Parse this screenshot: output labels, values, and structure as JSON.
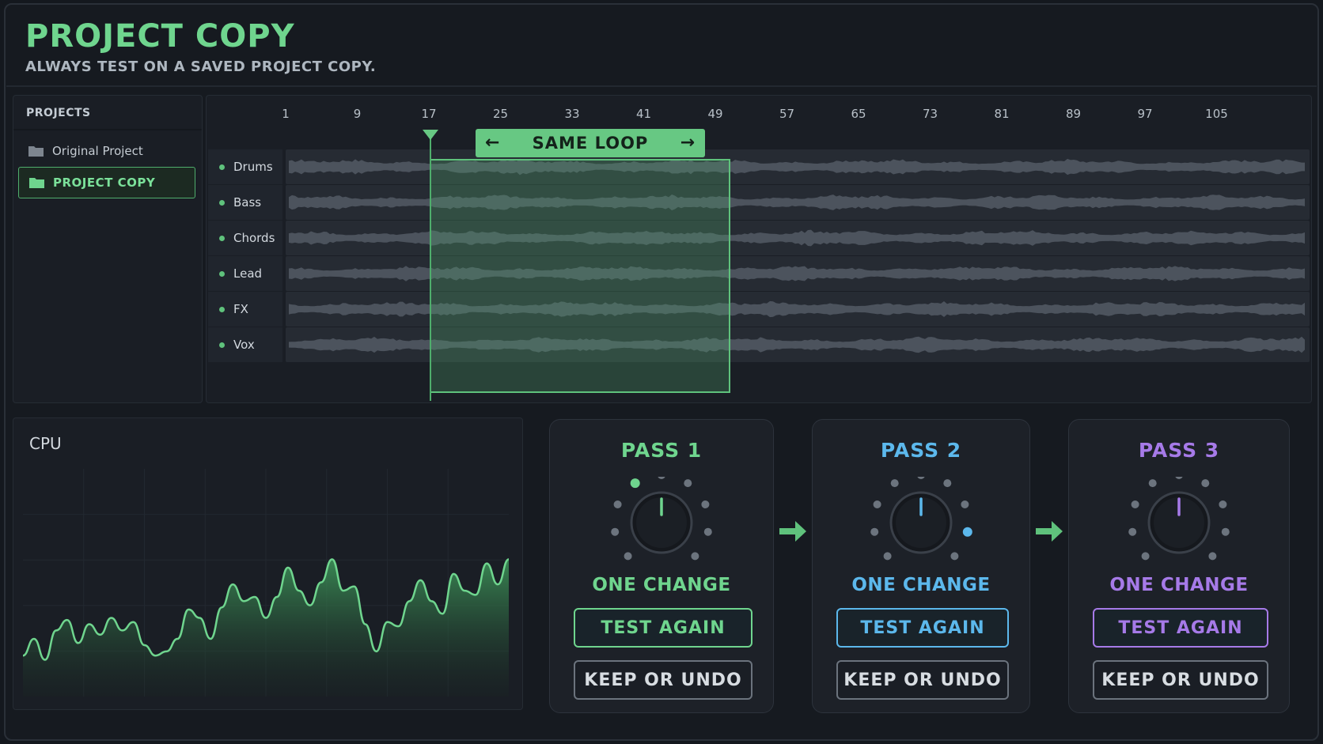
{
  "header": {
    "title": "PROJECT COPY",
    "subtitle": "ALWAYS TEST ON A SAVED PROJECT COPY."
  },
  "projects": {
    "heading": "PROJECTS",
    "items": [
      {
        "label": "Original Project",
        "icon": "folder-icon",
        "active": false
      },
      {
        "label": "PROJECT COPY",
        "icon": "folder-icon",
        "active": true
      }
    ]
  },
  "timeline": {
    "ruler_ticks": [
      "1",
      "9",
      "17",
      "25",
      "33",
      "41",
      "49",
      "57",
      "65",
      "73",
      "81",
      "89",
      "97",
      "105"
    ],
    "tracks": [
      {
        "name": "Drums"
      },
      {
        "name": "Bass"
      },
      {
        "name": "Chords"
      },
      {
        "name": "Lead"
      },
      {
        "name": "FX"
      },
      {
        "name": "Vox"
      }
    ],
    "loop": {
      "label": "SAME LOOP",
      "left_arrow": "←",
      "right_arrow": "→",
      "start_bar": 17,
      "end_bar": 49
    },
    "playhead_bar": 17
  },
  "cpu": {
    "title": "CPU",
    "series": [
      0.12,
      0.2,
      0.1,
      0.24,
      0.29,
      0.18,
      0.27,
      0.22,
      0.3,
      0.24,
      0.28,
      0.17,
      0.12,
      0.14,
      0.2,
      0.34,
      0.3,
      0.2,
      0.35,
      0.46,
      0.38,
      0.4,
      0.3,
      0.4,
      0.54,
      0.43,
      0.36,
      0.47,
      0.58,
      0.43,
      0.45,
      0.27,
      0.14,
      0.28,
      0.26,
      0.38,
      0.48,
      0.38,
      0.32,
      0.51,
      0.43,
      0.41,
      0.56,
      0.46,
      0.58
    ]
  },
  "flow_arrow_icon": "arrow-right-icon",
  "passes": [
    {
      "title": "PASS 1",
      "change": "ONE CHANGE",
      "test": "TEST AGAIN",
      "keep": "KEEP OR UNDO",
      "color": "#6fd58e",
      "active_dot": 3
    },
    {
      "title": "PASS 2",
      "change": "ONE CHANGE",
      "test": "TEST AGAIN",
      "keep": "KEEP OR UNDO",
      "color": "#5cb8ec",
      "active_dot": 7
    },
    {
      "title": "PASS 3",
      "change": "ONE CHANGE",
      "test": "TEST AGAIN",
      "keep": "KEEP OR UNDO",
      "color": "#a67ae8",
      "active_dot": -1
    }
  ]
}
